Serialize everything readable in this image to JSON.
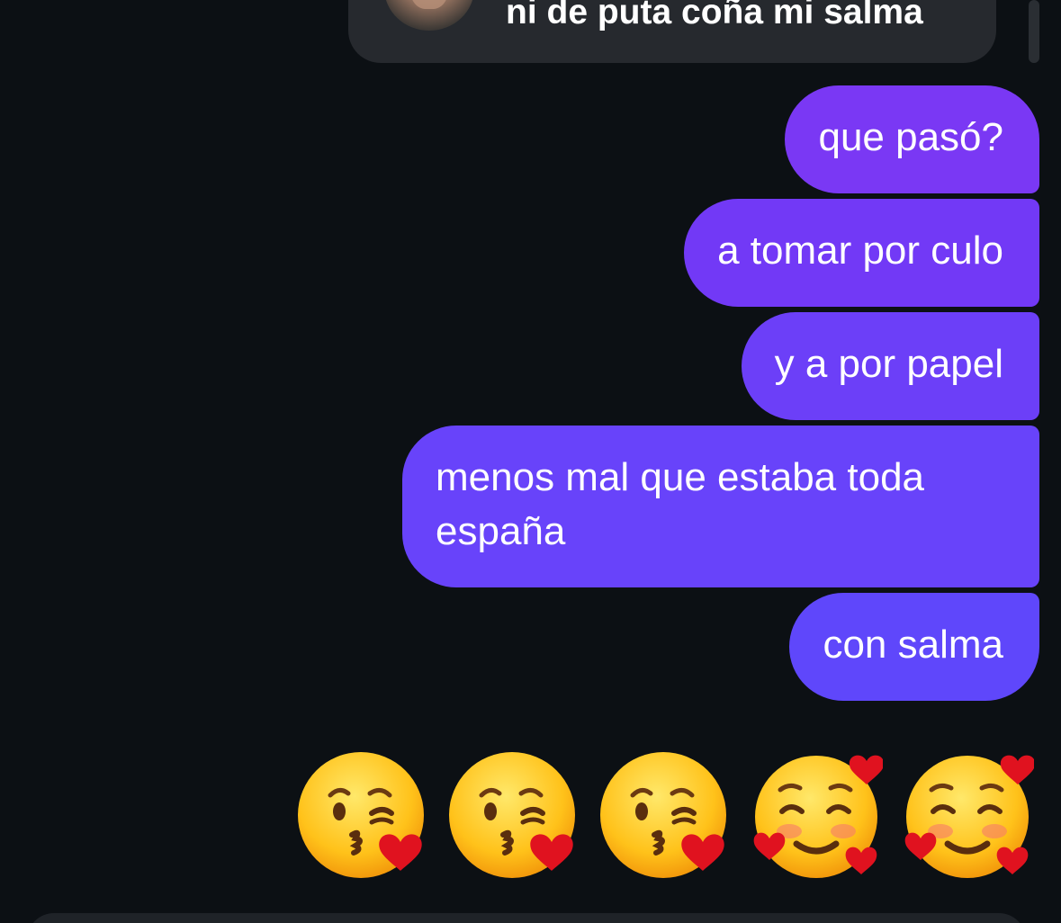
{
  "reply": {
    "text": "ni de puta coña mi salma"
  },
  "messages": [
    {
      "text": "que pasó?"
    },
    {
      "text": "a tomar por culo"
    },
    {
      "text": "y a por papel"
    },
    {
      "text": "menos mal que estaba toda españa"
    },
    {
      "text": "con salma"
    }
  ],
  "emojis": [
    "kissing-face-with-heart-icon",
    "kissing-face-with-heart-icon",
    "kissing-face-with-heart-icon",
    "smiling-face-with-hearts-icon",
    "smiling-face-with-hearts-icon"
  ],
  "colors": {
    "background": "#0c1014",
    "bubble_top": "#7a38f4",
    "bubble_bottom": "#5f47fb",
    "reply_card": "#26292e"
  }
}
